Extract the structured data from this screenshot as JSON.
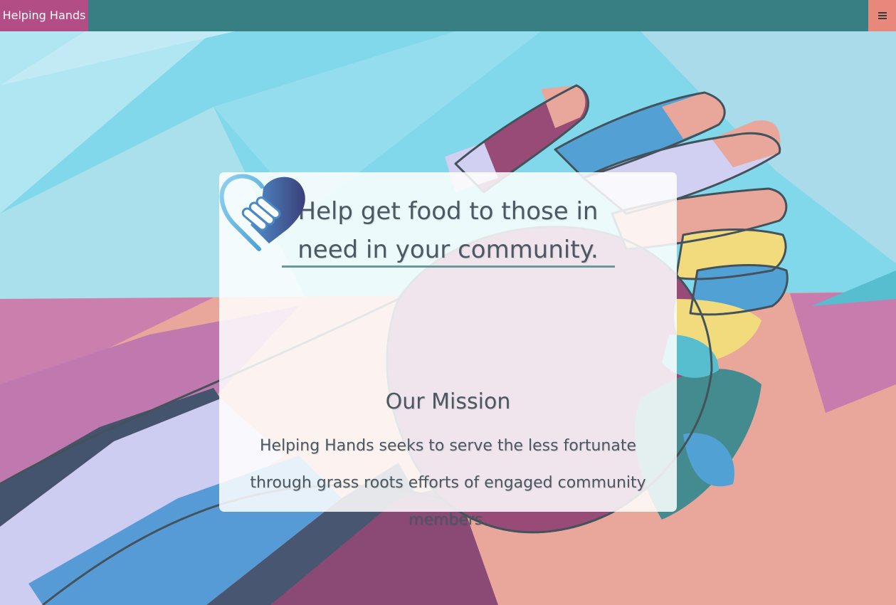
{
  "nav": {
    "brand": "Helping Hands",
    "menu_icon": "hamburger-menu-icon"
  },
  "hero": {
    "headline": "Help get food to those in need in your community.",
    "logo_icon": "heart-handshake-icon",
    "mission_title": "Our Mission",
    "mission_text": "Helping Hands seeks to serve the less fortunate through grass roots efforts of engaged community members."
  },
  "colors": {
    "navbar": "#377f82",
    "brand_bg": "#b34d86",
    "menu_bg": "#e8887a",
    "accent_line": "#6a9a98",
    "text": "#4a5862"
  }
}
